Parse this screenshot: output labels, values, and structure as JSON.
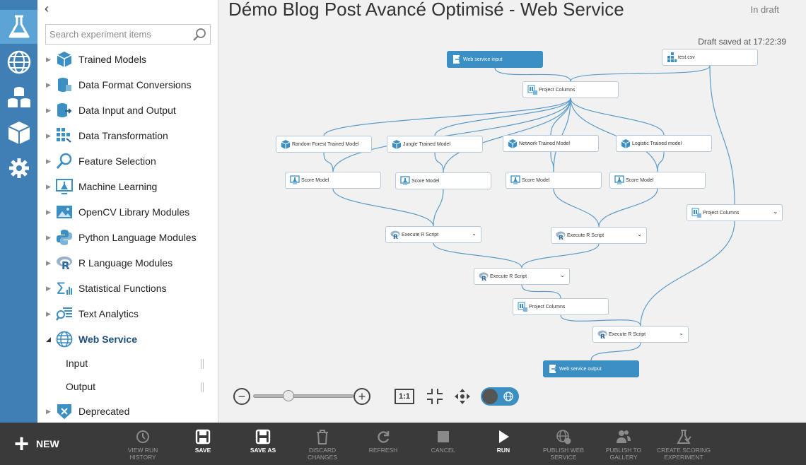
{
  "rail": {
    "items": [
      {
        "icon": "flask-icon",
        "active": true
      },
      {
        "icon": "globe-icon"
      },
      {
        "icon": "datasets-icon"
      },
      {
        "icon": "cube-icon"
      },
      {
        "icon": "gear-icon"
      }
    ],
    "colors": {
      "rail_bg": "#3f7fb6",
      "rail_active": "#5aa5d6"
    }
  },
  "palette": {
    "collapse_glyph": "‹",
    "search_placeholder": "Search experiment items",
    "items": [
      {
        "label": "Trained Models",
        "icon": "cube-icon"
      },
      {
        "label": "Data Format Conversions",
        "icon": "database-icon"
      },
      {
        "label": "Data Input and Output",
        "icon": "data-io-icon"
      },
      {
        "label": "Data Transformation",
        "icon": "grid-icon"
      },
      {
        "label": "Feature Selection",
        "icon": "magnifier-icon"
      },
      {
        "label": "Machine Learning",
        "icon": "flask-screen-icon"
      },
      {
        "label": "OpenCV Library Modules",
        "icon": "image-icon"
      },
      {
        "label": "Python Language Modules",
        "icon": "python-icon"
      },
      {
        "label": "R Language Modules",
        "icon": "r-icon"
      },
      {
        "label": "Statistical Functions",
        "icon": "sigma-icon"
      },
      {
        "label": "Text Analytics",
        "icon": "text-icon"
      },
      {
        "label": "Web Service",
        "icon": "globe-icon",
        "expanded": true
      },
      {
        "label": "Deprecated",
        "icon": "deprecated-icon"
      }
    ],
    "web_service_children": [
      "Input",
      "Output"
    ]
  },
  "canvas": {
    "title": "Démo Blog Post Avancé Optimisé - Web Service",
    "status": "In draft",
    "saved": "Draft saved at 17:22:39",
    "nodes": [
      {
        "id": "ws_input",
        "label": "Web service input",
        "type": "ws"
      },
      {
        "id": "testcsv",
        "label": "test.csv"
      },
      {
        "id": "pc1",
        "label": "Project Columns"
      },
      {
        "id": "rf",
        "label": "Random Forest Trained Model"
      },
      {
        "id": "jungle",
        "label": "Jungle Trained Model"
      },
      {
        "id": "network",
        "label": "Network Trained Model"
      },
      {
        "id": "logistic",
        "label": "Logistic Trained model"
      },
      {
        "id": "score1",
        "label": "Score Model"
      },
      {
        "id": "score2",
        "label": "Score Model"
      },
      {
        "id": "score3",
        "label": "Score Model"
      },
      {
        "id": "score4",
        "label": "Score Model"
      },
      {
        "id": "pc_right",
        "label": "Project Columns",
        "dropdown": true
      },
      {
        "id": "er1",
        "label": "Execute R Script",
        "dropdown": true
      },
      {
        "id": "er2",
        "label": "Execute R Script",
        "dropdown": true
      },
      {
        "id": "er3",
        "label": "Execute R Script",
        "dropdown": true
      },
      {
        "id": "pc2",
        "label": "Project Columns"
      },
      {
        "id": "er4",
        "label": "Execute R Script",
        "dropdown": true
      },
      {
        "id": "ws_output",
        "label": "Web service output",
        "type": "ws"
      }
    ],
    "edges": [
      [
        "ws_input",
        "pc1"
      ],
      [
        "testcsv",
        "pc1"
      ],
      [
        "pc1",
        "rf"
      ],
      [
        "pc1",
        "jungle"
      ],
      [
        "pc1",
        "network"
      ],
      [
        "pc1",
        "logistic"
      ],
      [
        "pc1",
        "score1"
      ],
      [
        "pc1",
        "score2"
      ],
      [
        "pc1",
        "score3"
      ],
      [
        "pc1",
        "score4"
      ],
      [
        "rf",
        "score1"
      ],
      [
        "jungle",
        "score2"
      ],
      [
        "network",
        "score3"
      ],
      [
        "logistic",
        "score4"
      ],
      [
        "score1",
        "er1"
      ],
      [
        "score2",
        "er1"
      ],
      [
        "score3",
        "er2"
      ],
      [
        "score4",
        "er2"
      ],
      [
        "er1",
        "er3"
      ],
      [
        "er2",
        "er3"
      ],
      [
        "er3",
        "pc2"
      ],
      [
        "pc2",
        "er4"
      ],
      [
        "testcsv",
        "pc_right"
      ],
      [
        "pc_right",
        "er4"
      ],
      [
        "er4",
        "ws_output"
      ]
    ],
    "colors": {
      "edge": "#5b9bc7",
      "ws_node": "#3c8fc2"
    },
    "zoom": {
      "level": 0.35,
      "actual_size_label": "1:1"
    }
  },
  "command_bar": {
    "new_label": "NEW",
    "buttons": [
      {
        "label": "VIEW RUN HISTORY",
        "icon": "clock-icon",
        "enabled": false
      },
      {
        "label": "SAVE",
        "icon": "save-icon",
        "enabled": true
      },
      {
        "label": "SAVE AS",
        "icon": "save-as-icon",
        "enabled": true
      },
      {
        "label": "DISCARD CHANGES",
        "icon": "trash-icon",
        "enabled": false
      },
      {
        "label": "REFRESH",
        "icon": "refresh-icon",
        "enabled": false
      },
      {
        "label": "CANCEL",
        "icon": "stop-icon",
        "enabled": false
      },
      {
        "label": "RUN",
        "icon": "play-icon",
        "enabled": true
      },
      {
        "label": "PUBLISH WEB SERVICE",
        "icon": "publish-web-service-icon",
        "enabled": false
      },
      {
        "label": "PUBLISH TO GALLERY",
        "icon": "publish-gallery-icon",
        "enabled": false
      },
      {
        "label": "CREATE SCORING EXPERIMENT",
        "icon": "scoring-experiment-icon",
        "enabled": false
      }
    ]
  }
}
